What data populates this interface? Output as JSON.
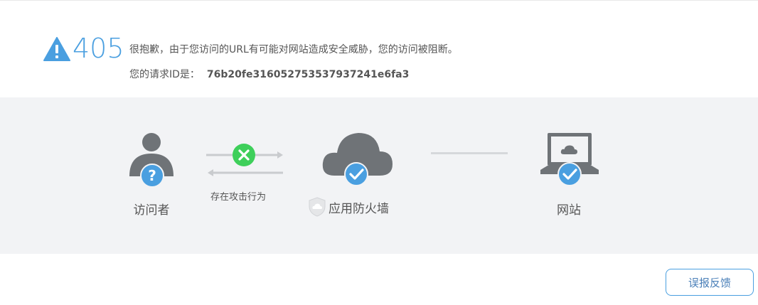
{
  "error": {
    "code": "405",
    "message": "很抱歉，由于您访问的URL有可能对网站造成安全威胁，您的访问被阻断。",
    "request_id_label": "您的请求ID是：",
    "request_id": "76b20fe316052753537937241e6fa3"
  },
  "diagram": {
    "visitor_label": "访问者",
    "attack_label": "存在攻击行为",
    "waf_label": "应用防火墙",
    "site_label": "网站"
  },
  "actions": {
    "feedback_label": "误报反馈"
  },
  "colors": {
    "accent": "#4a9fe0",
    "band_bg": "#f2f3f5",
    "icon_gray": "#6f7377",
    "block_green": "#3ecf5a"
  }
}
